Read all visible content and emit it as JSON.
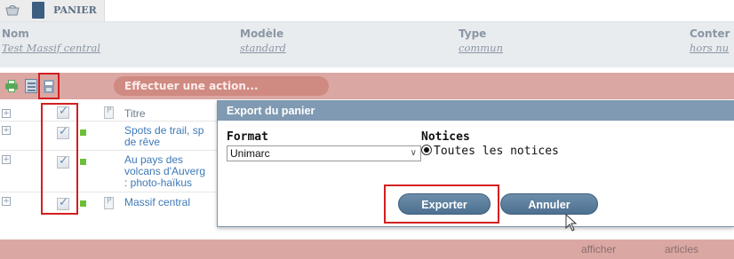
{
  "tab": {
    "label": "PANIER"
  },
  "info": {
    "columns": [
      {
        "label": "Nom",
        "value": "Test Massif central"
      },
      {
        "label": "Modèle",
        "value": "standard"
      },
      {
        "label": "Type",
        "value": "commun"
      },
      {
        "label": "Conter",
        "value": "hors nu"
      }
    ]
  },
  "actionbar": {
    "action_label": "Effectuer une action..."
  },
  "list": {
    "header": "Titre",
    "rows": [
      {
        "lines": [
          "Spots de trail, sp",
          "de rêve"
        ]
      },
      {
        "lines": [
          "Au pays des",
          "volcans d'Auverg",
          ": photo-haïkus"
        ]
      },
      {
        "lines": [
          "Massif central"
        ]
      }
    ]
  },
  "dialog": {
    "title": "Export du panier",
    "format_label": "Format",
    "format_value": "Unimarc",
    "notices_label": "Notices",
    "notices_option": "Toutes les notices",
    "export_button": "Exporter",
    "cancel_button": "Annuler"
  },
  "footer": {
    "afficher": "afficher",
    "articles": "articles"
  },
  "colors": {
    "accent_bar": "#dba7a3",
    "dialog_header": "#7f9ab2",
    "highlight": "#d31f1f",
    "link": "#3e79b8"
  }
}
